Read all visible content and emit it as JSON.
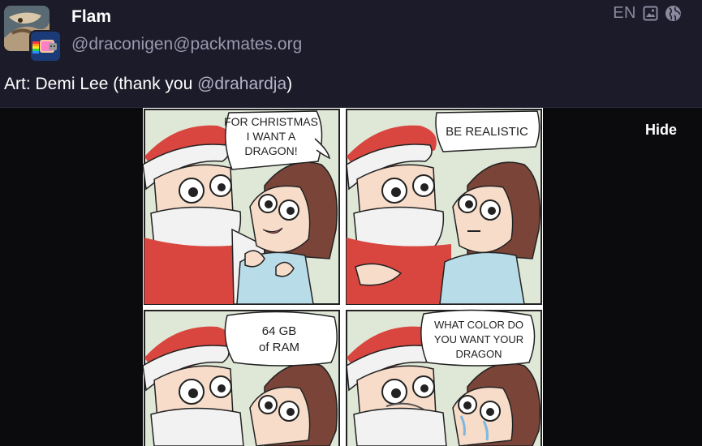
{
  "post": {
    "display_name": "Flam",
    "handle": "@draconigen@packmates.org",
    "language": "EN",
    "content_text": "Art: Demi Lee (thank you ",
    "content_mention": "@drahardja",
    "content_end": ")"
  },
  "media": {
    "hide_label": "Hide",
    "bubbles": {
      "p1": [
        "FOR CHRISTMAS",
        "I WANT A",
        "DRAGON!"
      ],
      "p2": [
        "BE REALISTIC"
      ],
      "p3": [
        "64 GB",
        "of RAM"
      ],
      "p4": [
        "WHAT COLOR DO",
        "YOU WANT YOUR",
        "DRAGON"
      ]
    }
  },
  "colors": {
    "background": "#1c1b29",
    "muted_text": "#9a98ae",
    "santa_red": "#d9463f",
    "panel_bg": "#dfe7d7"
  },
  "icons": {
    "media": "image-icon",
    "visibility": "globe-icon"
  }
}
